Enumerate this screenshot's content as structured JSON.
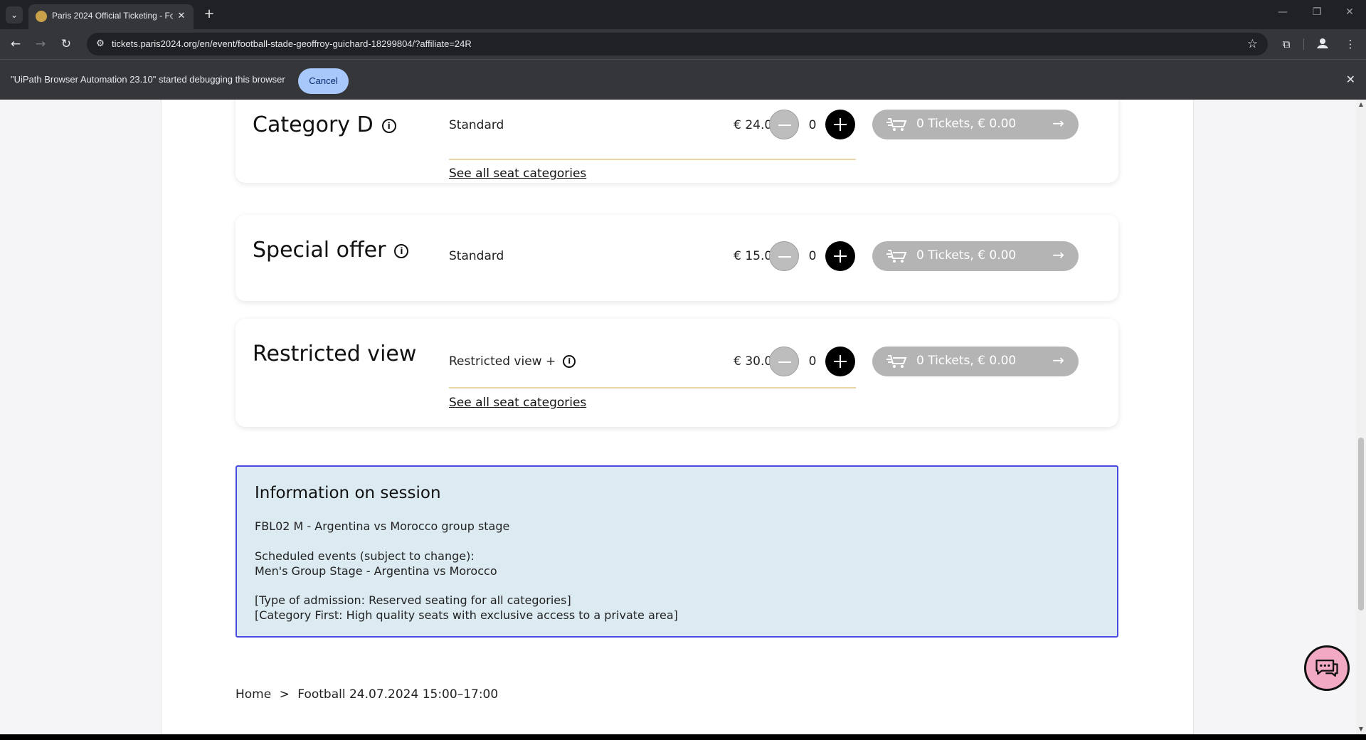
{
  "browser": {
    "tab_title": "Paris 2024 Official Ticketing - Fo",
    "url": "tickets.paris2024.org/en/event/football-stade-geoffroy-guichard-18299804/?affiliate=24R",
    "infobar_text": "\"UiPath Browser Automation 23.10\" started debugging this browser",
    "infobar_cancel": "Cancel"
  },
  "categories": [
    {
      "title": "Category D",
      "has_info": true,
      "label": "Standard",
      "price": "€ 24.00",
      "qty": "0",
      "cart_label": "0 Tickets, € 0.00",
      "see_all": "See all seat categories"
    },
    {
      "title": "Special offer",
      "has_info": true,
      "label": "Standard",
      "price": "€ 15.00",
      "qty": "0",
      "cart_label": "0 Tickets, € 0.00"
    },
    {
      "title": "Restricted view",
      "has_info": false,
      "label": "Restricted view +",
      "price": "€ 30.00",
      "qty": "0",
      "cart_label": "0 Tickets, € 0.00",
      "see_all": "See all seat categories"
    }
  ],
  "info_session": {
    "title": "Information on session",
    "line1": "FBL02 M - Argentina vs Morocco group stage",
    "line2": "Scheduled events (subject to change):",
    "line3": "Men's Group Stage - Argentina vs Morocco",
    "line4": "[Type of admission: Reserved seating for all categories]",
    "line5": "[Category First: High quality seats with exclusive access to a private area]"
  },
  "breadcrumb": {
    "home": "Home",
    "sep": ">",
    "current": "Football 24.07.2024 15:00–17:00"
  },
  "colors": {
    "accent_chat": "#f2a9c4",
    "cart_disabled": "#b4b4b4",
    "info_box_bg": "#dcebf2",
    "info_box_border": "#4a4ae0"
  }
}
